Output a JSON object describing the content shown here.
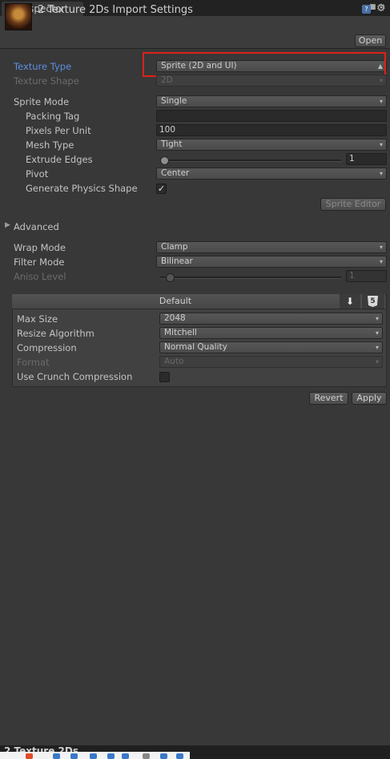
{
  "tab": {
    "label": "Inspector"
  },
  "header": {
    "title": "2 Texture 2Ds Import Settings",
    "open_label": "Open"
  },
  "rows": {
    "texture_type": {
      "label": "Texture Type",
      "value": "Sprite (2D and UI)"
    },
    "texture_shape": {
      "label": "Texture Shape",
      "value": "2D"
    },
    "sprite_mode": {
      "label": "Sprite Mode",
      "value": "Single"
    },
    "packing_tag": {
      "label": "Packing Tag",
      "value": ""
    },
    "pixels_per_unit": {
      "label": "Pixels Per Unit",
      "value": "100"
    },
    "mesh_type": {
      "label": "Mesh Type",
      "value": "Tight"
    },
    "extrude_edges": {
      "label": "Extrude Edges",
      "value": "1",
      "level": 0.0
    },
    "pivot": {
      "label": "Pivot",
      "value": "Center"
    },
    "generate_physics": {
      "label": "Generate Physics Shape",
      "checked": true
    },
    "sprite_editor_label": "Sprite Editor",
    "advanced_label": "Advanced",
    "wrap_mode": {
      "label": "Wrap Mode",
      "value": "Clamp"
    },
    "filter_mode": {
      "label": "Filter Mode",
      "value": "Bilinear"
    },
    "aniso_level": {
      "label": "Aniso Level",
      "value": "1",
      "level": 0.0
    }
  },
  "platform": {
    "default_tab": "Default",
    "max_size": {
      "label": "Max Size",
      "value": "2048"
    },
    "resize_algorithm": {
      "label": "Resize Algorithm",
      "value": "Mitchell"
    },
    "compression": {
      "label": "Compression",
      "value": "Normal Quality"
    },
    "format": {
      "label": "Format",
      "value": "Auto"
    },
    "crunch": {
      "label": "Use Crunch Compression",
      "checked": false
    }
  },
  "actions": {
    "revert_label": "Revert",
    "apply_label": "Apply"
  },
  "bottom": {
    "title": "2 Texture 2Ds"
  },
  "colors": {
    "highlight": "#e0201a",
    "active_label": "#5b8fe0",
    "background": "#383838"
  }
}
